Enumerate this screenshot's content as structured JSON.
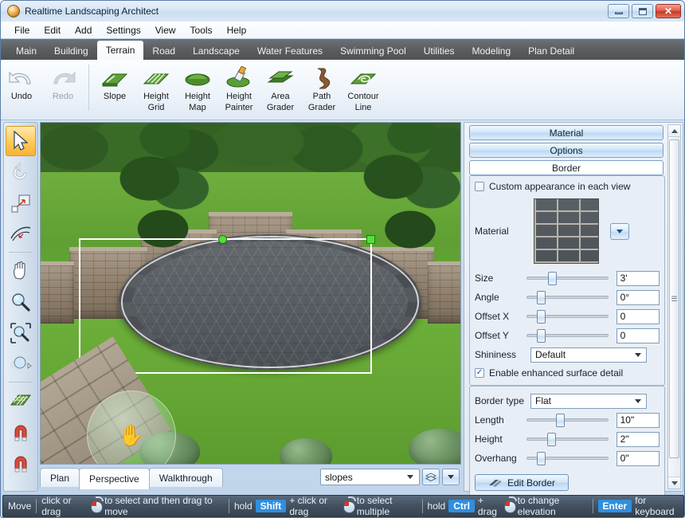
{
  "window": {
    "title": "Realtime Landscaping Architect",
    "app_icon": "app-globe-icon",
    "minimize_label": "",
    "maximize_label": "",
    "close_label": "✕"
  },
  "menubar": {
    "items": [
      "File",
      "Edit",
      "Add",
      "Settings",
      "View",
      "Tools",
      "Help"
    ]
  },
  "tabs": {
    "items": [
      "Main",
      "Building",
      "Terrain",
      "Road",
      "Landscape",
      "Water Features",
      "Swimming Pool",
      "Utilities",
      "Modeling",
      "Plan Detail"
    ],
    "active": "Terrain"
  },
  "ribbon": {
    "history": [
      {
        "label_line1": "Undo",
        "label_line2": "",
        "icon": "undo-arrow-icon",
        "enabled": true
      },
      {
        "label_line1": "Redo",
        "label_line2": "",
        "icon": "redo-arrow-icon",
        "enabled": false
      }
    ],
    "tools": [
      {
        "label_line1": "Slope",
        "label_line2": "",
        "icon": "slope-icon"
      },
      {
        "label_line1": "Height",
        "label_line2": "Grid",
        "icon": "height-grid-icon"
      },
      {
        "label_line1": "Height",
        "label_line2": "Map",
        "icon": "height-map-icon"
      },
      {
        "label_line1": "Height",
        "label_line2": "Painter",
        "icon": "height-painter-icon"
      },
      {
        "label_line1": "Area",
        "label_line2": "Grader",
        "icon": "area-grader-icon"
      },
      {
        "label_line1": "Path",
        "label_line2": "Grader",
        "icon": "path-grader-icon"
      },
      {
        "label_line1": "Contour",
        "label_line2": "Line",
        "icon": "contour-line-icon"
      }
    ]
  },
  "left_toolbar": {
    "items": [
      {
        "name": "select-arrow-tool",
        "icon": "arrow-cursor-icon",
        "active": true
      },
      {
        "name": "rotate-tool",
        "icon": "rotate-arrow-icon",
        "active": false
      },
      {
        "name": "scale-tool",
        "icon": "scale-square-icon",
        "active": false
      },
      {
        "name": "curve-tool",
        "icon": "curve-arc-icon",
        "active": false
      },
      {
        "name": "pan-tool",
        "icon": "hand-icon",
        "active": false
      },
      {
        "name": "zoom-tool",
        "icon": "magnifier-icon",
        "active": false
      },
      {
        "name": "zoom-window-tool",
        "icon": "magnifier-region-icon",
        "active": false
      },
      {
        "name": "orbit-tool",
        "icon": "orbit-icon",
        "active": false
      },
      {
        "name": "grid-tool",
        "icon": "grid-icon",
        "active": false
      },
      {
        "name": "snap-tool",
        "icon": "magnet-icon",
        "active": false
      },
      {
        "name": "snap-angle-tool",
        "icon": "magnet-icon",
        "active": false
      }
    ]
  },
  "viewport": {
    "scene_description": "3D perspective view of a backyard with a curved stone retaining wall, evergreen trees, lawn, a selected circular stone patio with white selection rectangle and green handles, a flagstone walkway and a translucent navigation orb with a hand cursor"
  },
  "view_tabs": {
    "items": [
      "Plan",
      "Perspective",
      "Walkthrough"
    ],
    "active": "Perspective"
  },
  "view_select": {
    "value": "slopes",
    "layers_icon": "layers-icon",
    "dropdown_icon": "chevron-down-icon"
  },
  "panel": {
    "section_buttons": [
      {
        "label": "Material",
        "current": false
      },
      {
        "label": "Options",
        "current": false
      },
      {
        "label": "Border",
        "current": true
      }
    ],
    "custom_appearance": {
      "label": "Custom appearance in each view",
      "checked": false
    },
    "material": {
      "label": "Material",
      "swatch_name": "stone-brick-texture",
      "dropdown_icon": "chevron-down-icon"
    },
    "sliders": [
      {
        "label": "Size",
        "value": "3'",
        "pos_pct": 26
      },
      {
        "label": "Angle",
        "value": "0°",
        "pos_pct": 12
      },
      {
        "label": "Offset X",
        "value": "0",
        "pos_pct": 12
      },
      {
        "label": "Offset Y",
        "value": "0",
        "pos_pct": 12
      }
    ],
    "shininess": {
      "label": "Shininess",
      "value": "Default"
    },
    "enhanced_detail": {
      "label": "Enable enhanced surface detail",
      "checked": true,
      "check_glyph": "✓"
    },
    "border_type": {
      "label": "Border type",
      "value": "Flat"
    },
    "border_sliders": [
      {
        "label": "Length",
        "value": "10\"",
        "pos_pct": 36
      },
      {
        "label": "Height",
        "value": "2\"",
        "pos_pct": 25
      },
      {
        "label": "Overhang",
        "value": "0\"",
        "pos_pct": 12
      }
    ],
    "edit_border": {
      "label": "Edit Border",
      "icon": "border-path-icon"
    },
    "scrollbar": {
      "up_icon": "scroll-up-icon",
      "down_icon": "scroll-down-icon",
      "grip_icon": "scroll-grip-icon"
    }
  },
  "statusbar": {
    "mode": "Move",
    "segments": [
      {
        "text_before": "click or drag",
        "mouse": true,
        "text_after": "to select and then drag to move",
        "key": ""
      },
      {
        "text_before": "hold",
        "key": "Shift",
        "text_mid": "+ click or drag",
        "mouse": true,
        "text_after": "to select multiple"
      },
      {
        "text_before": "hold",
        "key": "Ctrl",
        "text_mid": "+ drag",
        "mouse": true,
        "text_after": "to change elevation"
      },
      {
        "key": "Enter",
        "text_after": "for keyboard"
      }
    ]
  },
  "colors": {
    "accent_blue": "#2f8fe0",
    "tabstrip_dark": "#5b5e61",
    "statusbar_dark": "#42505f",
    "selection_green": "#53e03a",
    "close_red": "#c73a25"
  }
}
